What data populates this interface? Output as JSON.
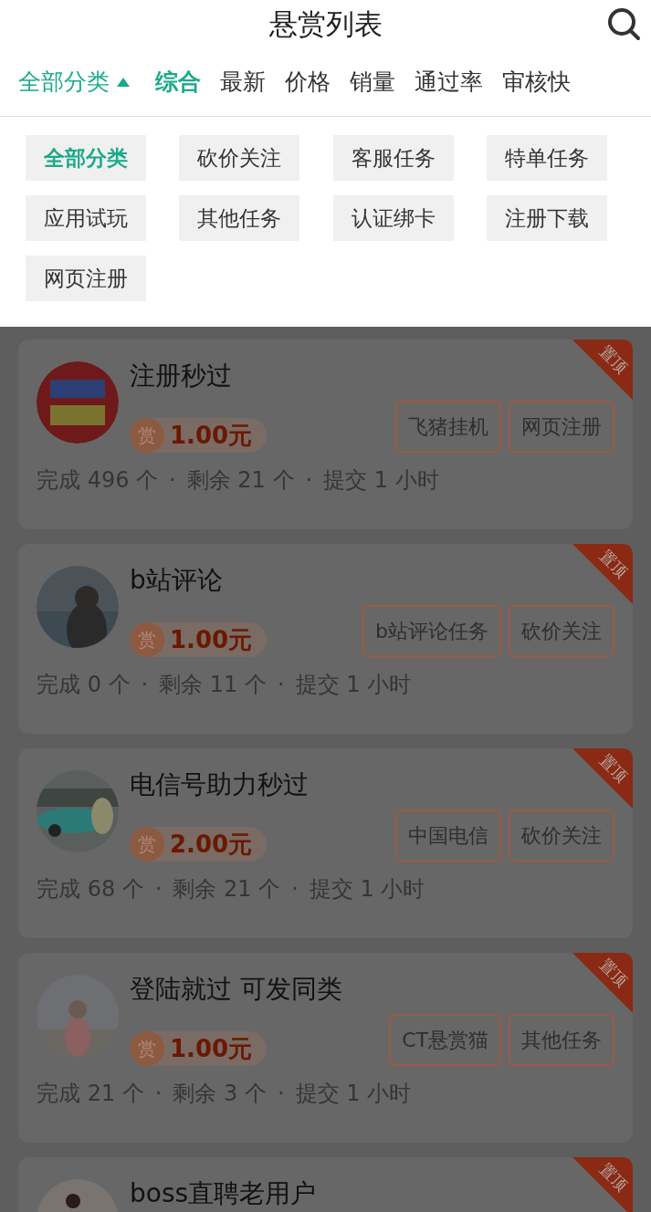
{
  "header": {
    "title": "悬赏列表"
  },
  "category_trigger": {
    "label": "全部分类",
    "expanded": true
  },
  "sort_tabs": [
    {
      "label": "综合",
      "selected": true
    },
    {
      "label": "最新",
      "selected": false
    },
    {
      "label": "价格",
      "selected": false
    },
    {
      "label": "销量",
      "selected": false
    },
    {
      "label": "通过率",
      "selected": false
    },
    {
      "label": "审核快",
      "selected": false
    }
  ],
  "categories": [
    {
      "label": "全部分类",
      "selected": true
    },
    {
      "label": "砍价关注",
      "selected": false
    },
    {
      "label": "客服任务",
      "selected": false
    },
    {
      "label": "特单任务",
      "selected": false
    },
    {
      "label": "应用试玩",
      "selected": false
    },
    {
      "label": "其他任务",
      "selected": false
    },
    {
      "label": "认证绑卡",
      "selected": false
    },
    {
      "label": "注册下载",
      "selected": false
    },
    {
      "label": "网页注册",
      "selected": false
    }
  ],
  "tasks": [
    {
      "title": "注册秒过",
      "reward_icon": "赏",
      "price": "1.00元",
      "tags": [
        "飞猪挂机",
        "网页注册"
      ],
      "done": "完成 496 个",
      "left": "剩余 21 个",
      "submit": "提交 1 小时",
      "pinned": true,
      "pin_label": "置顶",
      "separator": "·"
    },
    {
      "title": "b站评论",
      "reward_icon": "赏",
      "price": "1.00元",
      "tags": [
        "b站评论任务",
        "砍价关注"
      ],
      "done": "完成 0 个",
      "left": "剩余 11 个",
      "submit": "提交 1 小时",
      "pinned": true,
      "pin_label": "置顶",
      "separator": "·"
    },
    {
      "title": "电信号助力秒过",
      "reward_icon": "赏",
      "price": "2.00元",
      "tags": [
        "中国电信",
        "砍价关注"
      ],
      "done": "完成 68 个",
      "left": "剩余 21 个",
      "submit": "提交 1 小时",
      "pinned": true,
      "pin_label": "置顶",
      "separator": "·"
    },
    {
      "title": "登陆就过 可发同类",
      "reward_icon": "赏",
      "price": "1.00元",
      "tags": [
        "CT悬赏猫",
        "其他任务"
      ],
      "done": "完成 21 个",
      "left": "剩余 3 个",
      "submit": "提交 1 小时",
      "pinned": true,
      "pin_label": "置顶",
      "separator": "·"
    },
    {
      "title": "boss直聘老用户",
      "pinned": true,
      "pin_label": "置顶"
    }
  ]
}
